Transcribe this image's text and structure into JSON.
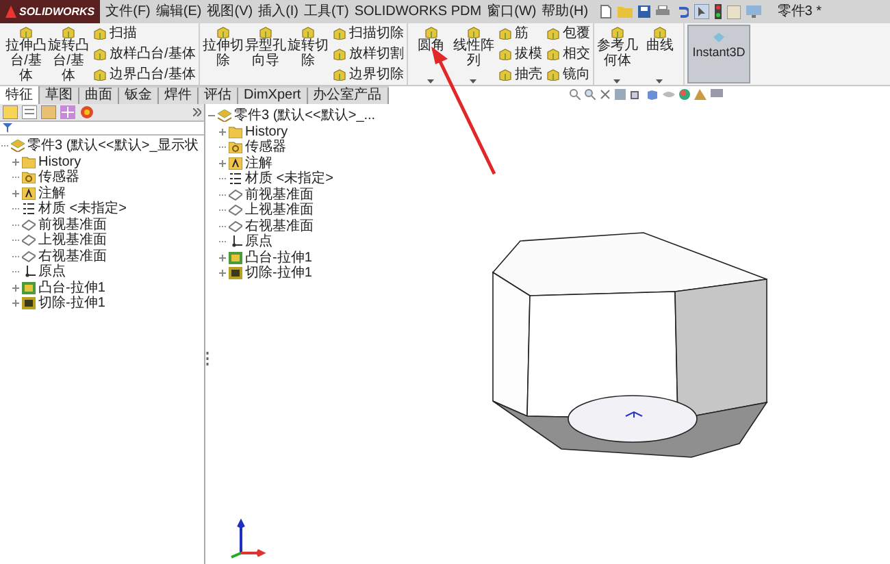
{
  "title_bar": {
    "logo": "SOLIDWORKS",
    "menu": [
      "文件(F)",
      "编辑(E)",
      "视图(V)",
      "插入(I)",
      "工具(T)",
      "SOLIDWORKS PDM",
      "窗口(W)",
      "帮助(H)"
    ],
    "document_title": "零件3 *"
  },
  "ribbon": {
    "groups": [
      {
        "large": [
          {
            "label": "拉伸凸台/基体",
            "dropdown": false
          },
          {
            "label": "旋转凸台/基体",
            "dropdown": false
          }
        ],
        "stacks": [
          [
            "扫描",
            "放样凸台/基体",
            "边界凸台/基体"
          ]
        ]
      },
      {
        "large": [
          {
            "label": "拉伸切除",
            "dropdown": false
          },
          {
            "label": "异型孔向导",
            "dropdown": false
          },
          {
            "label": "旋转切除",
            "dropdown": false
          }
        ],
        "stacks": [
          [
            "扫描切除",
            "放样切割",
            "边界切除"
          ]
        ]
      },
      {
        "large": [
          {
            "label": "圆角",
            "dropdown": true
          },
          {
            "label": "线性阵列",
            "dropdown": true
          }
        ],
        "stacks": [
          [
            "筋",
            "拔模",
            "抽壳"
          ],
          [
            "包覆",
            "相交",
            "镜向"
          ]
        ]
      },
      {
        "large": [
          {
            "label": "参考几何体",
            "dropdown": true
          },
          {
            "label": "曲线",
            "dropdown": true
          }
        ]
      }
    ],
    "instant3d": {
      "label": "Instant3D",
      "on": true
    }
  },
  "tabs": [
    {
      "label": "特征",
      "selected": true
    },
    {
      "label": "草图",
      "selected": false
    },
    {
      "label": "曲面",
      "selected": false
    },
    {
      "label": "钣金",
      "selected": false
    },
    {
      "label": "焊件",
      "selected": false
    },
    {
      "label": "评估",
      "selected": false
    },
    {
      "label": "DimXpert",
      "selected": false
    },
    {
      "label": "办公室产品",
      "selected": false
    }
  ],
  "feature_manager": {
    "tree": {
      "label": "零件3 (默认<<默认>_显示状",
      "kind": "part",
      "children": [
        {
          "label": "History",
          "kind": "folder",
          "expanded": false
        },
        {
          "label": "传感器",
          "kind": "sensor"
        },
        {
          "label": "注解",
          "kind": "annotation",
          "expanded": false
        },
        {
          "label": "材质 <未指定>",
          "kind": "material"
        },
        {
          "label": "前视基准面",
          "kind": "plane"
        },
        {
          "label": "上视基准面",
          "kind": "plane"
        },
        {
          "label": "右视基准面",
          "kind": "plane"
        },
        {
          "label": "原点",
          "kind": "origin"
        },
        {
          "label": "凸台-拉伸1",
          "kind": "boss",
          "expanded": false
        },
        {
          "label": "切除-拉伸1",
          "kind": "cut",
          "expanded": false
        }
      ]
    }
  },
  "flyout_tree": {
    "label": "零件3 (默认<<默认>_...",
    "kind": "part",
    "expanded": true,
    "children": [
      {
        "label": "History",
        "kind": "folder",
        "expanded": false
      },
      {
        "label": "传感器",
        "kind": "sensor"
      },
      {
        "label": "注解",
        "kind": "annotation",
        "expanded": false
      },
      {
        "label": "材质 <未指定>",
        "kind": "material"
      },
      {
        "label": "前视基准面",
        "kind": "plane"
      },
      {
        "label": "上视基准面",
        "kind": "plane"
      },
      {
        "label": "右视基准面",
        "kind": "plane"
      },
      {
        "label": "原点",
        "kind": "origin"
      },
      {
        "label": "凸台-拉伸1",
        "kind": "boss",
        "expanded": false
      },
      {
        "label": "切除-拉伸1",
        "kind": "cut",
        "expanded": false
      }
    ]
  }
}
